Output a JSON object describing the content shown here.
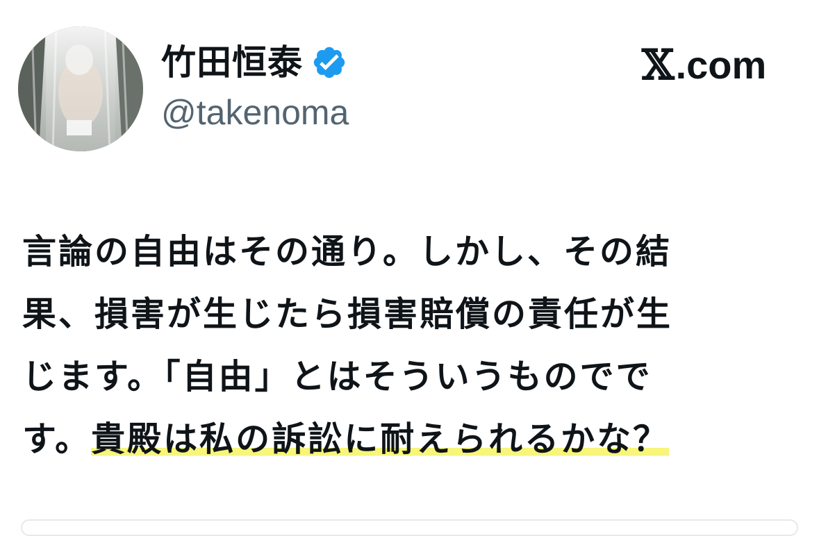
{
  "author": {
    "display_name": "竹田恒泰",
    "handle": "@takenoma",
    "avatar_icon": "profile-photo-waterfall",
    "verified_icon": "verified-badge-icon",
    "verified_color": "#1d9bf0"
  },
  "brand": {
    "x_mark": "𝕏",
    "domain_suffix": ".com"
  },
  "tweet": {
    "lines": [
      "言論の自由はその通り。しかし、その結",
      "果、損害が生じたら損害賠償の責任が生",
      "じます。「自由」とはそういうものでで",
      "す。"
    ],
    "line4_highlighted": "貴殿は私の訴訟に耐えられるかな？",
    "highlight_color": "#f7f57a"
  }
}
